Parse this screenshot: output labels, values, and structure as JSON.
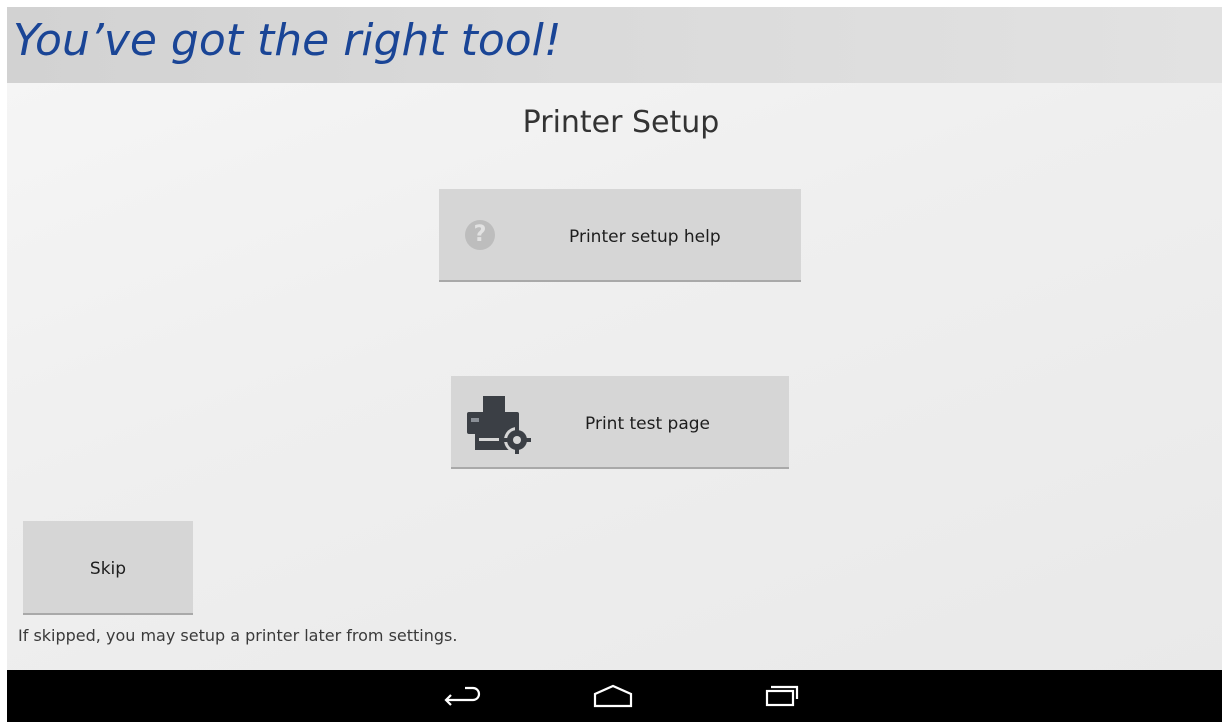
{
  "banner": {
    "title": "You’ve got the right tool!"
  },
  "page": {
    "title": "Printer Setup"
  },
  "buttons": {
    "help": {
      "label": "Printer setup help",
      "icon": "help-circle-icon"
    },
    "test_page": {
      "label": "Print test page",
      "icon": "printer-settings-icon"
    },
    "skip": {
      "label": "Skip"
    }
  },
  "skip_note": "If skipped, you may setup a printer later from settings.",
  "navbar": {
    "back_icon": "back-icon",
    "home_icon": "home-icon",
    "recents_icon": "recent-apps-icon"
  },
  "colors": {
    "banner_text": "#1a4596",
    "button_bg": "#d6d6d6",
    "navbar_bg": "#000000"
  }
}
